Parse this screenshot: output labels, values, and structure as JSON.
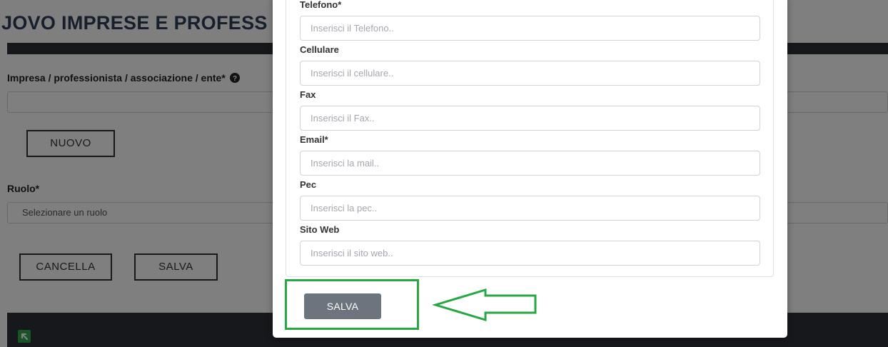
{
  "background": {
    "title": "JOVO IMPRESE E PROFESS",
    "company_label": "Impresa / professionista / associazione / ente*",
    "new_button": "NUOVO",
    "role_label": "Ruolo*",
    "role_select_value": "Selezionare un ruolo",
    "cancel_button": "CANCELLA",
    "save_button": "SALVA"
  },
  "modal": {
    "fields": [
      {
        "label": "Telefono*",
        "placeholder": "Inserisci il Telefono.."
      },
      {
        "label": "Cellulare",
        "placeholder": "Inserisci il cellulare.."
      },
      {
        "label": "Fax",
        "placeholder": "Inserisci il Fax.."
      },
      {
        "label": "Email*",
        "placeholder": "Inserisci la mail.."
      },
      {
        "label": "Pec",
        "placeholder": "Inserisci la pec.."
      },
      {
        "label": "Sito Web",
        "placeholder": "Inserisci il sito web.."
      }
    ],
    "save_button": "SALVA"
  },
  "colors": {
    "annotation": "#28a745",
    "save_button": "#6c757d",
    "dark_band": "#2e3136"
  },
  "icons": {
    "help": "question-circle-icon",
    "annotation_arrow": "arrow-left-outline-icon"
  }
}
